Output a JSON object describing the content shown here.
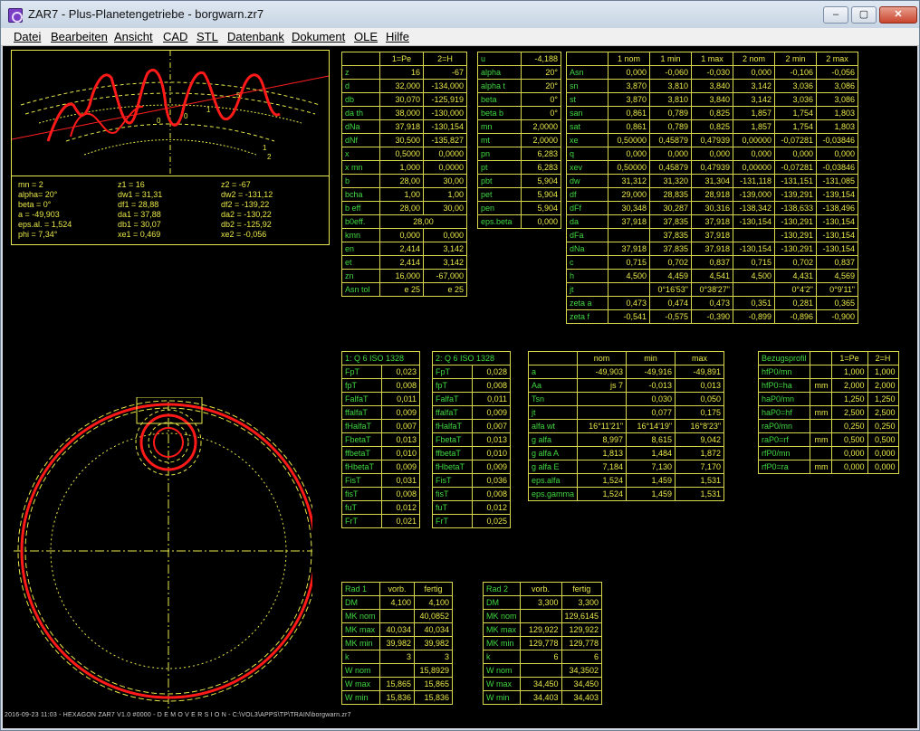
{
  "window": {
    "title": "ZAR7 - Plus-Planetengetriebe - borgwarn.zr7",
    "min": "–",
    "max": "▢",
    "close": "✕"
  },
  "menu": [
    "Datei",
    "Bearbeiten",
    "Ansicht",
    "CAD",
    "STL",
    "Datenbank",
    "Dokument",
    "OLE",
    "Hilfe"
  ],
  "params": {
    "rows": [
      [
        "mn = 2",
        "z1 = 16",
        "z2 = -67"
      ],
      [
        "alpha= 20°",
        "dw1 = 31,31",
        "dw2 = -131,12"
      ],
      [
        "beta = 0°",
        "df1 = 28,88",
        "df2 = -139,22"
      ],
      [
        "a = -49,903",
        "da1 = 37,88",
        "da2 = -130,22"
      ],
      [
        "eps.al. = 1,524",
        "db1 = 30,07",
        "db2 = -125,92"
      ],
      [
        "phi = 7,34°",
        "xe1 = 0,469",
        "xe2 = -0,056"
      ]
    ]
  },
  "gear_labels": [
    "5",
    "1",
    "0",
    "0",
    "1",
    "2"
  ],
  "table_gear": {
    "head": [
      "",
      "1=Pe",
      "2=H"
    ],
    "rows": [
      [
        "z",
        "16",
        "-67"
      ],
      [
        "d",
        "32,000",
        "-134,000"
      ],
      [
        "db",
        "30,070",
        "-125,919"
      ],
      [
        "da th",
        "38,000",
        "-130,000"
      ],
      [
        "dNa",
        "37,918",
        "-130,154"
      ],
      [
        "dNf",
        "30,500",
        "-135,827"
      ],
      [
        "x",
        "0,5000",
        "0,0000"
      ],
      [
        "x  mn",
        "1,000",
        "0,0000"
      ],
      [
        "b",
        "28,00",
        "30,00"
      ],
      [
        "bcha",
        "1,00",
        "1,00"
      ],
      [
        "b eff",
        "28,00",
        "30,00"
      ]
    ],
    "span_row": [
      "b0eff.",
      "28,00"
    ],
    "rows2": [
      [
        "kmn",
        "0,000",
        "0,000"
      ],
      [
        "en",
        "2,414",
        "3,142"
      ],
      [
        "et",
        "2,414",
        "3,142"
      ],
      [
        "zn",
        "16,000",
        "-67,000"
      ],
      [
        "Asn tol",
        "e 25",
        "e 25"
      ]
    ]
  },
  "table_angles": {
    "rows": [
      [
        "u",
        "-4,188"
      ],
      [
        "alpha",
        "20°"
      ],
      [
        "alpha t",
        "20°"
      ],
      [
        "beta",
        "0°"
      ],
      [
        "beta b",
        "0°"
      ],
      [
        "mn",
        "2,0000"
      ],
      [
        "mt",
        "2,0000"
      ],
      [
        "pn",
        "6,283"
      ],
      [
        "pt",
        "6,283"
      ],
      [
        "pbt",
        "5,904"
      ],
      [
        "pet",
        "5,904"
      ],
      [
        "pen",
        "5,904"
      ],
      [
        "eps.beta",
        "0,000"
      ]
    ]
  },
  "table_tol": {
    "head": [
      "",
      "1 nom",
      "1 min",
      "1 max",
      "2 nom",
      "2 min",
      "2 max"
    ],
    "rows": [
      [
        "Asn",
        "0,000",
        "-0,060",
        "-0,030",
        "0,000",
        "-0,106",
        "-0,056"
      ],
      [
        "sn",
        "3,870",
        "3,810",
        "3,840",
        "3,142",
        "3,036",
        "3,086"
      ],
      [
        "st",
        "3,870",
        "3,810",
        "3,840",
        "3,142",
        "3,036",
        "3,086"
      ],
      [
        "san",
        "0,861",
        "0,789",
        "0,825",
        "1,857",
        "1,754",
        "1,803"
      ],
      [
        "sat",
        "0,861",
        "0,789",
        "0,825",
        "1,857",
        "1,754",
        "1,803"
      ],
      [
        "xe",
        "0,50000",
        "0,45879",
        "0,47939",
        "0,00000",
        "-0,07281",
        "-0,03846"
      ],
      [
        "q",
        "0,000",
        "0,000",
        "0,000",
        "0,000",
        "0,000",
        "0,000"
      ],
      [
        "xev",
        "0,50000",
        "0,45879",
        "0,47939",
        "0,00000",
        "-0,07281",
        "-0,03846"
      ],
      [
        "dw",
        "31,312",
        "31,320",
        "31,304",
        "-131,118",
        "-131,151",
        "-131,085"
      ],
      [
        "df",
        "29,000",
        "28,835",
        "28,918",
        "-139,000",
        "-139,291",
        "-139,154"
      ],
      [
        "dFf",
        "30,348",
        "30,287",
        "30,316",
        "-138,342",
        "-138,633",
        "-138,496"
      ],
      [
        "da",
        "37,918",
        "37,835",
        "37,918",
        "-130,154",
        "-130,291",
        "-130,154"
      ],
      [
        "dFa",
        "",
        "37,835",
        "37,918",
        "",
        "-130,291",
        "-130,154"
      ],
      [
        "dNa",
        "37,918",
        "37,835",
        "37,918",
        "-130,154",
        "-130,291",
        "-130,154"
      ],
      [
        "c",
        "0,715",
        "0,702",
        "0,837",
        "0,715",
        "0,702",
        "0,837"
      ],
      [
        "h",
        "4,500",
        "4,459",
        "4,541",
        "4,500",
        "4,431",
        "4,569"
      ],
      [
        "jt",
        "",
        "0°16'53\"",
        "0°38'27\"",
        "",
        "0°4'2\"",
        "0°9'11\""
      ],
      [
        "zeta a",
        "0,473",
        "0,474",
        "0,473",
        "0,351",
        "0,281",
        "0,365"
      ],
      [
        "zeta f",
        "-0,541",
        "-0,575",
        "-0,390",
        "-0,899",
        "-0,896",
        "-0,900"
      ]
    ]
  },
  "table_q1": {
    "head": "1: Q 6   ISO 1328",
    "rows": [
      [
        "FpT",
        "0,023"
      ],
      [
        "fpT",
        "0,008"
      ],
      [
        "FalfaT",
        "0,011"
      ],
      [
        "ffalfaT",
        "0,009"
      ],
      [
        "fHalfaT",
        "0,007"
      ],
      [
        "FbetaT",
        "0,013"
      ],
      [
        "ffbetaT",
        "0,010"
      ],
      [
        "fHbetaT",
        "0,009"
      ],
      [
        "FisT",
        "0,031"
      ],
      [
        "fisT",
        "0,008"
      ],
      [
        "fuT",
        "0,012"
      ],
      [
        "FrT",
        "0,021"
      ]
    ]
  },
  "table_q2": {
    "head": "2: Q 6   ISO 1328",
    "rows": [
      [
        "FpT",
        "0,028"
      ],
      [
        "fpT",
        "0,008"
      ],
      [
        "FalfaT",
        "0,011"
      ],
      [
        "ffalfaT",
        "0,009"
      ],
      [
        "fHalfaT",
        "0,007"
      ],
      [
        "FbetaT",
        "0,013"
      ],
      [
        "ffbetaT",
        "0,010"
      ],
      [
        "fHbetaT",
        "0,009"
      ],
      [
        "FisT",
        "0,036"
      ],
      [
        "fisT",
        "0,008"
      ],
      [
        "fuT",
        "0,012"
      ],
      [
        "FrT",
        "0,025"
      ]
    ]
  },
  "table_mesh": {
    "head": [
      "",
      "nom",
      "min",
      "max"
    ],
    "rows": [
      [
        "a",
        "-49,903",
        "-49,916",
        "-49,891"
      ],
      [
        "Aa",
        "js 7",
        "-0,013",
        "0,013"
      ],
      [
        "Tsn",
        "",
        "0,030",
        "0,050"
      ],
      [
        "jt",
        "",
        "0,077",
        "0,175"
      ],
      [
        "alfa wt",
        "16°11'21\"",
        "16°14'19\"",
        "16°8'23\""
      ],
      [
        "g alfa",
        "8,997",
        "8,615",
        "9,042"
      ],
      [
        "g alfa A",
        "1,813",
        "1,484",
        "1,872"
      ],
      [
        "g alfa E",
        "7,184",
        "7,130",
        "7,170"
      ],
      [
        "eps.alfa",
        "1,524",
        "1,459",
        "1,531"
      ],
      [
        "eps.gamma",
        "1,524",
        "1,459",
        "1,531"
      ]
    ]
  },
  "table_ref": {
    "head": [
      "Bezugsprofil",
      "",
      "1=Pe",
      "2=H"
    ],
    "rows": [
      [
        "hfP0/mn",
        "",
        "1,000",
        "1,000"
      ],
      [
        "hfP0=ha",
        "mm",
        "2,000",
        "2,000"
      ],
      [
        "haP0/mn",
        "",
        "1,250",
        "1,250"
      ],
      [
        "haP0=hf",
        "mm",
        "2,500",
        "2,500"
      ],
      [
        "raP0/mn",
        "",
        "0,250",
        "0,250"
      ],
      [
        "raP0=rf",
        "mm",
        "0,500",
        "0,500"
      ],
      [
        "rfP0/mn",
        "",
        "0,000",
        "0,000"
      ],
      [
        "rfP0=ra",
        "mm",
        "0,000",
        "0,000"
      ]
    ]
  },
  "table_rad1": {
    "head": [
      "Rad 1",
      "vorb.",
      "fertig"
    ],
    "rows": [
      [
        "DM",
        "4,100",
        "4,100"
      ],
      [
        "MK nom",
        "",
        "40,0852"
      ],
      [
        "MK max",
        "40,034",
        "40,034"
      ],
      [
        "MK min",
        "39,982",
        "39,982"
      ],
      [
        "k",
        "3",
        "3"
      ],
      [
        "W nom",
        "",
        "15,8929"
      ],
      [
        "W max",
        "15,865",
        "15,865"
      ],
      [
        "W min",
        "15,836",
        "15,836"
      ]
    ]
  },
  "table_rad2": {
    "head": [
      "Rad 2",
      "vorb.",
      "fertig"
    ],
    "rows": [
      [
        "DM",
        "3,300",
        "3,300"
      ],
      [
        "MK nom",
        "",
        "129,6145"
      ],
      [
        "MK max",
        "129,922",
        "129,922"
      ],
      [
        "MK min",
        "129,778",
        "129,778"
      ],
      [
        "k",
        "6",
        "6"
      ],
      [
        "W nom",
        "",
        "34,3502"
      ],
      [
        "W max",
        "34,450",
        "34,450"
      ],
      [
        "W min",
        "34,403",
        "34,403"
      ]
    ]
  },
  "footer": "2016-09-23 11:03 - HEXAGON ZAR7 V1.0 #0000 - D E M O V E R S I O N - C:\\VOL3\\APPS\\TP\\TRAIN\\borgwarn.zr7",
  "colors": {
    "background": "#000000",
    "grid_line": "#e8e84a",
    "label": "#40d840",
    "gear": "#ff1a1a"
  }
}
